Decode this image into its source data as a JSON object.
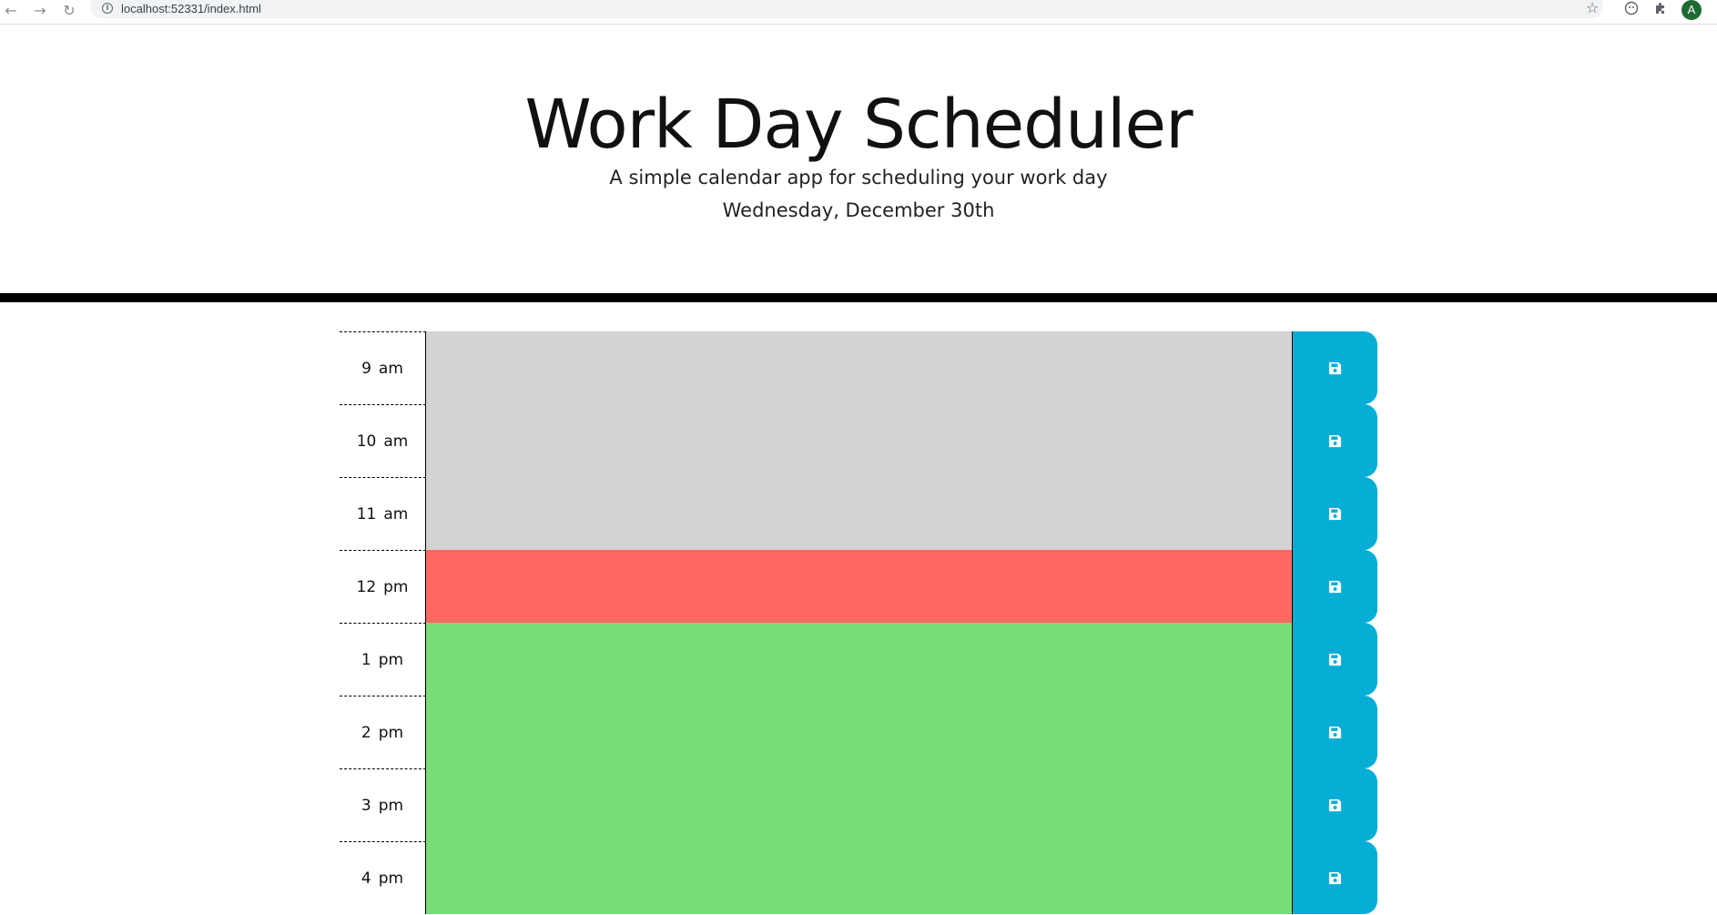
{
  "browser": {
    "url": "localhost:52331/index.html",
    "account_initial": "A",
    "back_glyph": "←",
    "forward_glyph": "→",
    "reload_glyph": "↻",
    "info_glyph": "i",
    "star_glyph": "☆"
  },
  "header": {
    "title": "Work Day Scheduler",
    "subtitle": "A simple calendar app for scheduling your work day",
    "current_day": "Wednesday, December 30th"
  },
  "colors": {
    "past": "#d3d3d3",
    "present": "#ff6961",
    "future": "#77dd77",
    "save_button": "#06aed5"
  },
  "timeblocks": [
    {
      "hour": "9",
      "period": "am",
      "status": "past",
      "text": ""
    },
    {
      "hour": "10",
      "period": "am",
      "status": "past",
      "text": ""
    },
    {
      "hour": "11",
      "period": "am",
      "status": "past",
      "text": ""
    },
    {
      "hour": "12",
      "period": "pm",
      "status": "present",
      "text": ""
    },
    {
      "hour": "1",
      "period": "pm",
      "status": "future",
      "text": ""
    },
    {
      "hour": "2",
      "period": "pm",
      "status": "future",
      "text": ""
    },
    {
      "hour": "3",
      "period": "pm",
      "status": "future",
      "text": ""
    },
    {
      "hour": "4",
      "period": "pm",
      "status": "future",
      "text": ""
    }
  ],
  "save_icon": "floppy-disk-icon"
}
